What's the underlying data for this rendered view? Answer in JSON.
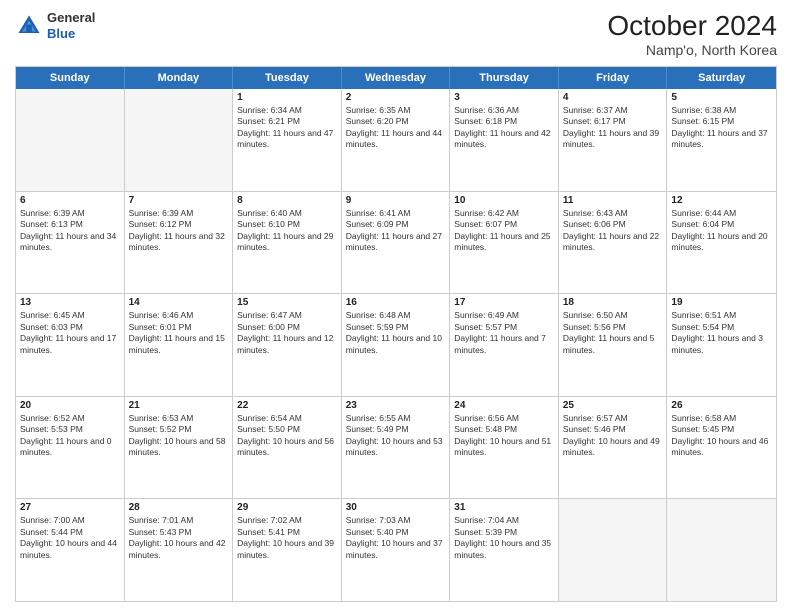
{
  "header": {
    "logo_general": "General",
    "logo_blue": "Blue",
    "month_year": "October 2024",
    "location": "Namp'o, North Korea"
  },
  "weekdays": [
    "Sunday",
    "Monday",
    "Tuesday",
    "Wednesday",
    "Thursday",
    "Friday",
    "Saturday"
  ],
  "weeks": [
    [
      {
        "day": "",
        "sunrise": "",
        "sunset": "",
        "daylight": "",
        "empty": true
      },
      {
        "day": "",
        "sunrise": "",
        "sunset": "",
        "daylight": "",
        "empty": true
      },
      {
        "day": "1",
        "sunrise": "Sunrise: 6:34 AM",
        "sunset": "Sunset: 6:21 PM",
        "daylight": "Daylight: 11 hours and 47 minutes."
      },
      {
        "day": "2",
        "sunrise": "Sunrise: 6:35 AM",
        "sunset": "Sunset: 6:20 PM",
        "daylight": "Daylight: 11 hours and 44 minutes."
      },
      {
        "day": "3",
        "sunrise": "Sunrise: 6:36 AM",
        "sunset": "Sunset: 6:18 PM",
        "daylight": "Daylight: 11 hours and 42 minutes."
      },
      {
        "day": "4",
        "sunrise": "Sunrise: 6:37 AM",
        "sunset": "Sunset: 6:17 PM",
        "daylight": "Daylight: 11 hours and 39 minutes."
      },
      {
        "day": "5",
        "sunrise": "Sunrise: 6:38 AM",
        "sunset": "Sunset: 6:15 PM",
        "daylight": "Daylight: 11 hours and 37 minutes."
      }
    ],
    [
      {
        "day": "6",
        "sunrise": "Sunrise: 6:39 AM",
        "sunset": "Sunset: 6:13 PM",
        "daylight": "Daylight: 11 hours and 34 minutes."
      },
      {
        "day": "7",
        "sunrise": "Sunrise: 6:39 AM",
        "sunset": "Sunset: 6:12 PM",
        "daylight": "Daylight: 11 hours and 32 minutes."
      },
      {
        "day": "8",
        "sunrise": "Sunrise: 6:40 AM",
        "sunset": "Sunset: 6:10 PM",
        "daylight": "Daylight: 11 hours and 29 minutes."
      },
      {
        "day": "9",
        "sunrise": "Sunrise: 6:41 AM",
        "sunset": "Sunset: 6:09 PM",
        "daylight": "Daylight: 11 hours and 27 minutes."
      },
      {
        "day": "10",
        "sunrise": "Sunrise: 6:42 AM",
        "sunset": "Sunset: 6:07 PM",
        "daylight": "Daylight: 11 hours and 25 minutes."
      },
      {
        "day": "11",
        "sunrise": "Sunrise: 6:43 AM",
        "sunset": "Sunset: 6:06 PM",
        "daylight": "Daylight: 11 hours and 22 minutes."
      },
      {
        "day": "12",
        "sunrise": "Sunrise: 6:44 AM",
        "sunset": "Sunset: 6:04 PM",
        "daylight": "Daylight: 11 hours and 20 minutes."
      }
    ],
    [
      {
        "day": "13",
        "sunrise": "Sunrise: 6:45 AM",
        "sunset": "Sunset: 6:03 PM",
        "daylight": "Daylight: 11 hours and 17 minutes."
      },
      {
        "day": "14",
        "sunrise": "Sunrise: 6:46 AM",
        "sunset": "Sunset: 6:01 PM",
        "daylight": "Daylight: 11 hours and 15 minutes."
      },
      {
        "day": "15",
        "sunrise": "Sunrise: 6:47 AM",
        "sunset": "Sunset: 6:00 PM",
        "daylight": "Daylight: 11 hours and 12 minutes."
      },
      {
        "day": "16",
        "sunrise": "Sunrise: 6:48 AM",
        "sunset": "Sunset: 5:59 PM",
        "daylight": "Daylight: 11 hours and 10 minutes."
      },
      {
        "day": "17",
        "sunrise": "Sunrise: 6:49 AM",
        "sunset": "Sunset: 5:57 PM",
        "daylight": "Daylight: 11 hours and 7 minutes."
      },
      {
        "day": "18",
        "sunrise": "Sunrise: 6:50 AM",
        "sunset": "Sunset: 5:56 PM",
        "daylight": "Daylight: 11 hours and 5 minutes."
      },
      {
        "day": "19",
        "sunrise": "Sunrise: 6:51 AM",
        "sunset": "Sunset: 5:54 PM",
        "daylight": "Daylight: 11 hours and 3 minutes."
      }
    ],
    [
      {
        "day": "20",
        "sunrise": "Sunrise: 6:52 AM",
        "sunset": "Sunset: 5:53 PM",
        "daylight": "Daylight: 11 hours and 0 minutes."
      },
      {
        "day": "21",
        "sunrise": "Sunrise: 6:53 AM",
        "sunset": "Sunset: 5:52 PM",
        "daylight": "Daylight: 10 hours and 58 minutes."
      },
      {
        "day": "22",
        "sunrise": "Sunrise: 6:54 AM",
        "sunset": "Sunset: 5:50 PM",
        "daylight": "Daylight: 10 hours and 56 minutes."
      },
      {
        "day": "23",
        "sunrise": "Sunrise: 6:55 AM",
        "sunset": "Sunset: 5:49 PM",
        "daylight": "Daylight: 10 hours and 53 minutes."
      },
      {
        "day": "24",
        "sunrise": "Sunrise: 6:56 AM",
        "sunset": "Sunset: 5:48 PM",
        "daylight": "Daylight: 10 hours and 51 minutes."
      },
      {
        "day": "25",
        "sunrise": "Sunrise: 6:57 AM",
        "sunset": "Sunset: 5:46 PM",
        "daylight": "Daylight: 10 hours and 49 minutes."
      },
      {
        "day": "26",
        "sunrise": "Sunrise: 6:58 AM",
        "sunset": "Sunset: 5:45 PM",
        "daylight": "Daylight: 10 hours and 46 minutes."
      }
    ],
    [
      {
        "day": "27",
        "sunrise": "Sunrise: 7:00 AM",
        "sunset": "Sunset: 5:44 PM",
        "daylight": "Daylight: 10 hours and 44 minutes."
      },
      {
        "day": "28",
        "sunrise": "Sunrise: 7:01 AM",
        "sunset": "Sunset: 5:43 PM",
        "daylight": "Daylight: 10 hours and 42 minutes."
      },
      {
        "day": "29",
        "sunrise": "Sunrise: 7:02 AM",
        "sunset": "Sunset: 5:41 PM",
        "daylight": "Daylight: 10 hours and 39 minutes."
      },
      {
        "day": "30",
        "sunrise": "Sunrise: 7:03 AM",
        "sunset": "Sunset: 5:40 PM",
        "daylight": "Daylight: 10 hours and 37 minutes."
      },
      {
        "day": "31",
        "sunrise": "Sunrise: 7:04 AM",
        "sunset": "Sunset: 5:39 PM",
        "daylight": "Daylight: 10 hours and 35 minutes."
      },
      {
        "day": "",
        "sunrise": "",
        "sunset": "",
        "daylight": "",
        "empty": true
      },
      {
        "day": "",
        "sunrise": "",
        "sunset": "",
        "daylight": "",
        "empty": true
      }
    ]
  ]
}
